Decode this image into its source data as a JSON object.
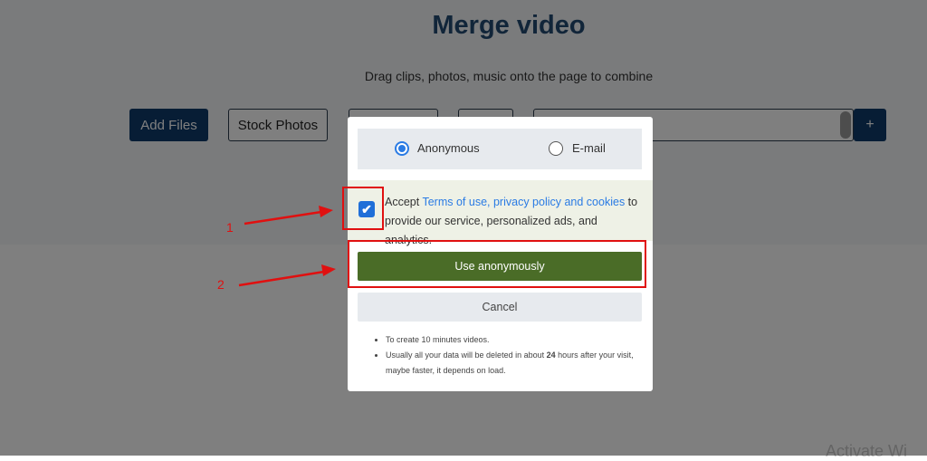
{
  "page": {
    "title": "Merge video",
    "subtitle": "Drag clips, photos, music onto the page to combine",
    "add_files_label": "Add Files",
    "stock_photos_label": "Stock Photos",
    "plus_label": "+",
    "watermark": "Activate Wi"
  },
  "modal": {
    "options": [
      {
        "label": "Anonymous",
        "selected": true
      },
      {
        "label": "E-mail",
        "selected": false
      }
    ],
    "consent": {
      "checked": true,
      "prefix": "Accept ",
      "link1": "Terms of use",
      "sep": ", ",
      "link2": "privacy policy and cookies",
      "suffix": " to provide our service, personalized ads, and analytics."
    },
    "use_button": "Use anonymously",
    "cancel_button": "Cancel",
    "notes": {
      "note1": "To create 10 minutes videos.",
      "note2_before": "Usually all your data will be deleted in about ",
      "note2_bold": "24",
      "note2_after": " hours after your visit, maybe faster, it depends on load."
    }
  },
  "annotations": {
    "label1": "1",
    "label2": "2",
    "color": "#e01010"
  },
  "colors": {
    "primary": "#0f3b6b",
    "use_button_bg": "#4a6c27",
    "link": "#2a7be4",
    "title": "#234b73"
  }
}
